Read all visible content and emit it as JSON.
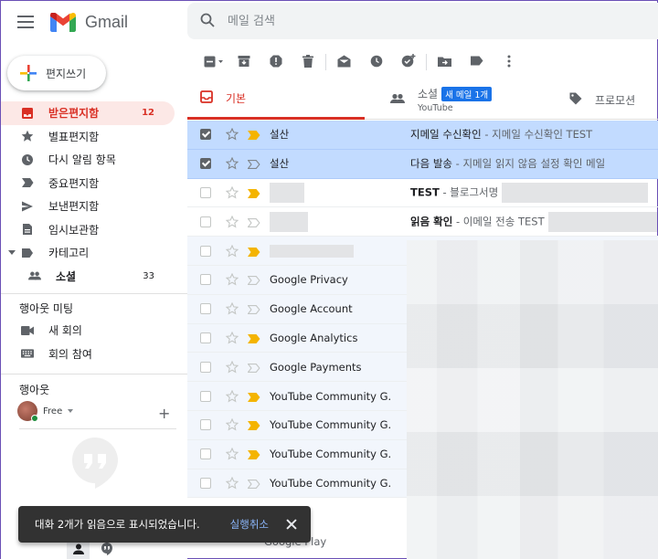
{
  "app": {
    "name": "Gmail"
  },
  "search": {
    "placeholder": "메일 검색"
  },
  "compose": {
    "label": "편지쓰기"
  },
  "sidebar": {
    "items": [
      {
        "label": "받은편지함",
        "count": "12"
      },
      {
        "label": "별표편지함",
        "count": ""
      },
      {
        "label": "다시 알림 항목",
        "count": ""
      },
      {
        "label": "중요편지함",
        "count": ""
      },
      {
        "label": "보낸편지함",
        "count": ""
      },
      {
        "label": "임시보관함",
        "count": ""
      },
      {
        "label": "카테고리",
        "count": ""
      },
      {
        "label": "소셜",
        "count": "33"
      }
    ]
  },
  "meet": {
    "title": "행아웃 미팅",
    "new_meeting": "새 회의",
    "join_meeting": "회의 참여"
  },
  "hangouts": {
    "title": "행아웃",
    "status": "Free"
  },
  "tabs": {
    "primary": "기본",
    "social": "소셜",
    "social_badge": "새 메일 1개",
    "social_sub": "YouTube",
    "promotions": "프로모션"
  },
  "emails": [
    {
      "sender": "설산",
      "subject": "지메일 수신확인",
      "snippet": " - 지메일 수신확인 TEST"
    },
    {
      "sender": "설산",
      "subject": "다음 발송",
      "snippet": " - 지메일 읽지 않음 설정 확인 메일"
    },
    {
      "sender": "",
      "subject": "TEST",
      "snippet": " - 블로그서명"
    },
    {
      "sender": "",
      "subject": "읽음 확인",
      "snippet": " - 이메일 전송 TEST"
    },
    {
      "sender": "",
      "subject": "",
      "snippet": ""
    },
    {
      "sender": "Google Privacy",
      "subject": "",
      "snippet": ""
    },
    {
      "sender": "Google Account",
      "subject": "",
      "snippet": ""
    },
    {
      "sender": "Google Analytics",
      "subject": "",
      "snippet": ""
    },
    {
      "sender": "Google Payments",
      "subject": "",
      "snippet": ""
    },
    {
      "sender": "YouTube Community G.",
      "subject": "",
      "snippet": ""
    },
    {
      "sender": "YouTube Community G.",
      "subject": "",
      "snippet": ""
    },
    {
      "sender": "YouTube Community G.",
      "subject": "",
      "snippet": ""
    },
    {
      "sender": "YouTube Community G.",
      "subject": "",
      "snippet": ""
    }
  ],
  "last_sender": "Google Play",
  "snackbar": {
    "text": "대화 2개가 읽음으로 표시되었습니다.",
    "undo": "실행취소"
  },
  "colors": {
    "accent": "#d93025",
    "selected": "#c2dbff",
    "badge": "#1a73e8"
  }
}
